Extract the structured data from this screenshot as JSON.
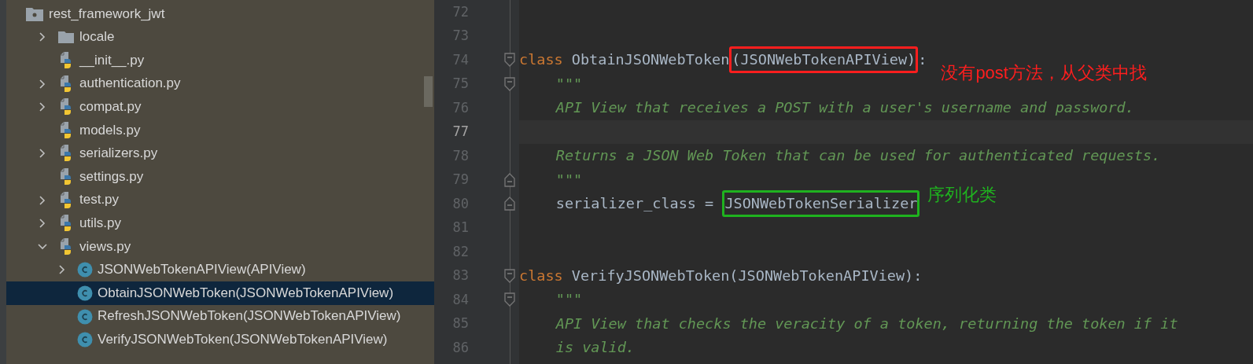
{
  "project_tree": {
    "items": [
      {
        "label": "rest_framework_jwt",
        "kind": "root",
        "selected": false,
        "children": [
          {
            "label": "locale",
            "kind": "folder",
            "expanded": false,
            "selected": false
          },
          {
            "label": "__init__.py",
            "kind": "python",
            "selected": false
          },
          {
            "label": "authentication.py",
            "kind": "python",
            "expanded": false,
            "selected": false
          },
          {
            "label": "compat.py",
            "kind": "python",
            "expanded": false,
            "selected": false
          },
          {
            "label": "models.py",
            "kind": "python",
            "selected": false
          },
          {
            "label": "serializers.py",
            "kind": "python",
            "expanded": false,
            "selected": false
          },
          {
            "label": "settings.py",
            "kind": "python",
            "selected": false
          },
          {
            "label": "test.py",
            "kind": "python",
            "expanded": false,
            "selected": false
          },
          {
            "label": "utils.py",
            "kind": "python",
            "expanded": false,
            "selected": false
          },
          {
            "label": "views.py",
            "kind": "python",
            "expanded": true,
            "selected": false,
            "children": [
              {
                "label": "JSONWebTokenAPIView(APIView)",
                "kind": "class",
                "expanded": false,
                "selected": false
              },
              {
                "label": "ObtainJSONWebToken(JSONWebTokenAPIView)",
                "kind": "class",
                "selected": true
              },
              {
                "label": "RefreshJSONWebToken(JSONWebTokenAPIView)",
                "kind": "class",
                "selected": false
              },
              {
                "label": "VerifyJSONWebToken(JSONWebTokenAPIView)",
                "kind": "class",
                "selected": false
              }
            ]
          }
        ]
      }
    ]
  },
  "editor": {
    "lines": [
      {
        "number": "72",
        "current": false
      },
      {
        "number": "73",
        "current": false
      },
      {
        "number": "74",
        "current": false,
        "fold_open": true,
        "tokens": [
          {
            "kind": "keyword",
            "text": "class"
          },
          {
            "kind": "plain",
            "text": " ObtainJSONWebToken"
          },
          {
            "kind": "plain",
            "text": "(JSONWebTokenAPIView)",
            "color": "#ff1e1e"
          },
          {
            "kind": "plain",
            "text": ":"
          }
        ],
        "note": {
          "text": "没有post方法，从父类中找",
          "color": "#ff1e1e"
        }
      },
      {
        "number": "75",
        "current": false,
        "fold_open": true,
        "indented": true,
        "tokens": [
          {
            "kind": "comment",
            "text": "\"\"\""
          }
        ]
      },
      {
        "number": "76",
        "current": false,
        "indented": true,
        "tokens": [
          {
            "kind": "comment",
            "text": "API View that receives a POST with a user's username and password."
          }
        ]
      },
      {
        "number": "77",
        "current": true
      },
      {
        "number": "78",
        "current": false,
        "indented": true,
        "tokens": [
          {
            "kind": "comment",
            "text": "Returns a JSON Web Token that can be used for authenticated requests."
          }
        ]
      },
      {
        "number": "79",
        "current": false,
        "fold_close": true,
        "indented": true,
        "tokens": [
          {
            "kind": "comment",
            "text": "\"\"\""
          }
        ]
      },
      {
        "number": "80",
        "current": false,
        "fold_close": true,
        "indented": true,
        "tokens": [
          {
            "kind": "plain",
            "text": "serializer_class = "
          },
          {
            "kind": "plain",
            "text": "JSONWebTokenSerializer",
            "color": "#1fb21f"
          }
        ],
        "note": {
          "text": "序列化类",
          "color": "#1fb21f"
        }
      },
      {
        "number": "81",
        "current": false
      },
      {
        "number": "82",
        "current": false
      },
      {
        "number": "83",
        "current": false,
        "fold_open": true,
        "tokens": [
          {
            "kind": "keyword",
            "text": "class"
          },
          {
            "kind": "plain",
            "text": " VerifyJSONWebToken(JSONWebTokenAPIView):"
          }
        ]
      },
      {
        "number": "84",
        "current": false,
        "fold_open": true,
        "indented": true,
        "tokens": [
          {
            "kind": "comment",
            "text": "\"\"\""
          }
        ]
      },
      {
        "number": "85",
        "current": false,
        "indented": true,
        "tokens": [
          {
            "kind": "comment",
            "text": "API View that checks the veracity of a token, returning the token if it"
          }
        ]
      },
      {
        "number": "86",
        "current": false,
        "indented": true,
        "tokens": [
          {
            "kind": "comment",
            "text": "is valid."
          }
        ]
      }
    ]
  }
}
